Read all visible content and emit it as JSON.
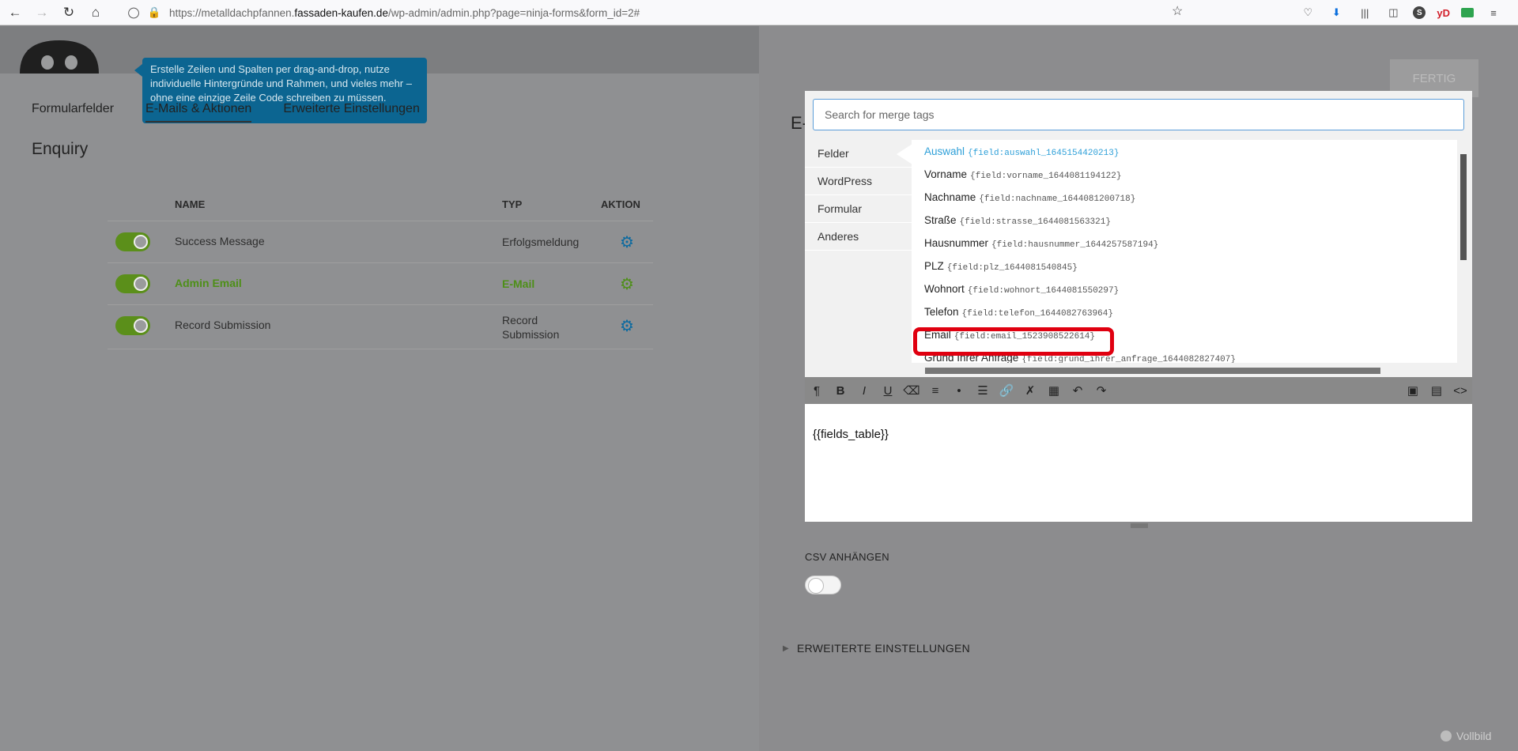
{
  "browser": {
    "url_prefix": "https://metalldachpfannen.",
    "url_domain": "fassaden-kaufen.de",
    "url_path": "/wp-admin/admin.php?page=ninja-forms&form_id=2#",
    "avatar_letter": "S",
    "yd_label": "yD"
  },
  "left": {
    "tooltip": "Erstelle Zeilen und Spalten per drag-and-drop, nutze individuelle Hintergründe und Rahmen, und vieles mehr – ohne eine einzige Zeile Code schreiben zu müssen.",
    "tabs": [
      "Formularfelder",
      "E-Mails & Aktionen",
      "Erweiterte Einstellungen"
    ],
    "form_title": "Enquiry",
    "table": {
      "headers": {
        "name": "NAME",
        "typ": "TYP",
        "aktion": "AKTION"
      },
      "rows": [
        {
          "name": "Success Message",
          "typ": "Erfolgsmeldung"
        },
        {
          "name": "Admin Email",
          "typ": "E-Mail"
        },
        {
          "name": "Record Submission",
          "typ": "Record Submission"
        }
      ]
    }
  },
  "drawer": {
    "done_label": "FERTIG",
    "title_fragment": "E-",
    "merge": {
      "search_placeholder": "Search for merge tags",
      "categories": [
        "Felder",
        "WordPress",
        "Formular",
        "Anderes"
      ],
      "items": [
        {
          "label": "Auswahl",
          "tag": "{field:auswahl_1645154420213}"
        },
        {
          "label": "Vorname",
          "tag": "{field:vorname_1644081194122}"
        },
        {
          "label": "Nachname",
          "tag": "{field:nachname_1644081200718}"
        },
        {
          "label": "Straße",
          "tag": "{field:strasse_1644081563321}"
        },
        {
          "label": "Hausnummer",
          "tag": "{field:hausnummer_1644257587194}"
        },
        {
          "label": "PLZ",
          "tag": "{field:plz_1644081540845}"
        },
        {
          "label": "Wohnort",
          "tag": "{field:wohnort_1644081550297}"
        },
        {
          "label": "Telefon",
          "tag": "{field:telefon_1644082763964}"
        },
        {
          "label": "Email",
          "tag": "{field:email_1523908522614}"
        },
        {
          "label": "Grund Ihrer Anfrage",
          "tag": "{field:grund_ihrer_anfrage_1644082827407}"
        }
      ]
    },
    "editor_content": "{{fields_table}}",
    "csv_label": "CSV ANHÄNGEN",
    "advanced_label": "ERWEITERTE EINSTELLUNGEN",
    "fullscreen_label": "Vollbild"
  },
  "colors": {
    "accent_green": "#5b8f1a",
    "accent_blue": "#0b6aa0",
    "highlight_red": "#e00010",
    "link_blue": "#2d9fd8"
  }
}
